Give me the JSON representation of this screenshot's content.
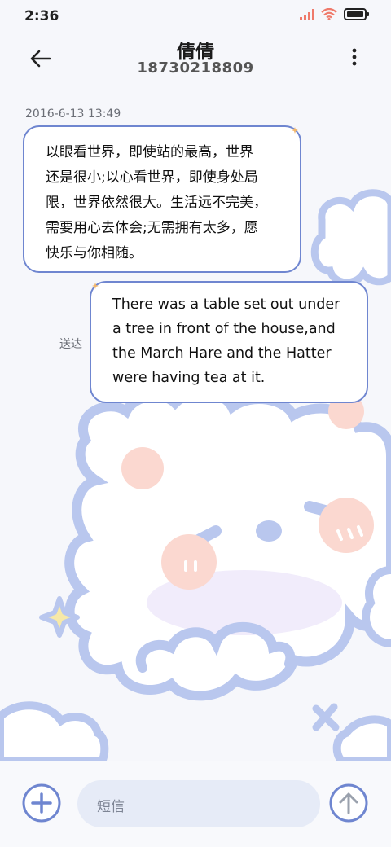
{
  "status_bar": {
    "time": "2:36",
    "icons": [
      "signal-icon",
      "wifi-icon",
      "battery-icon"
    ],
    "accent_color": "#ef7a6b"
  },
  "header": {
    "contact_name": "倩倩",
    "phone_number": "18730218809",
    "back_icon": "back-arrow-icon",
    "more_icon": "more-vertical-icon"
  },
  "conversation": {
    "timestamp": "2016-6-13 13:49",
    "messages": [
      {
        "direction": "incoming",
        "lines": [
          "以眼看世界，即使站的最高，世界",
          "还是很小;以心看世界，即使身处局",
          "限，世界依然很大。生活远不完美，",
          "需要用心去体会;无需拥有太多，愿",
          "快乐与你相随。"
        ]
      },
      {
        "direction": "outgoing",
        "lines": [
          "There was a table set out under",
          "a tree in front of the house,and",
          "the March Hare and the Hatter",
          "were having tea at it."
        ],
        "status": "送达"
      }
    ]
  },
  "composer": {
    "placeholder": "短信",
    "add_icon": "add-icon",
    "send_icon": "send-arrow-icon"
  },
  "theme": {
    "bubble_border": "#6f86d0",
    "cloud_color": "#b9c7ee",
    "blush_color": "#fbd8d0"
  }
}
